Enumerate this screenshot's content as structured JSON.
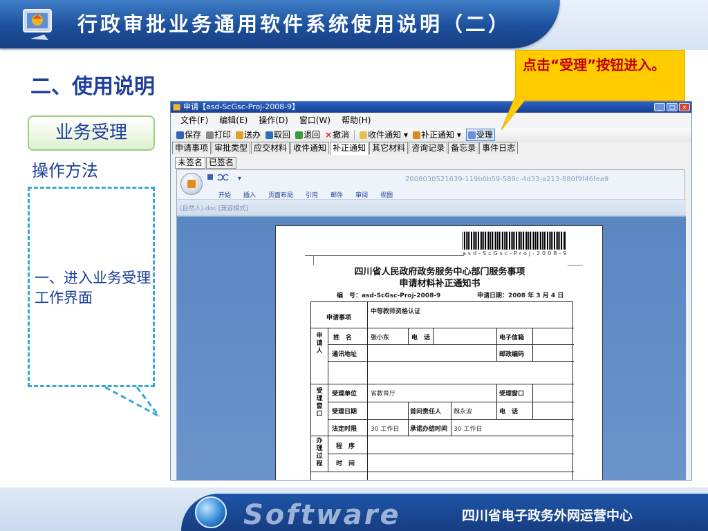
{
  "header": {
    "title": "行政审批业务通用软件系统使用说明（二）"
  },
  "section": {
    "heading": "二、使用说明",
    "button": "业务受理",
    "method": "操作方法",
    "note": "一、进入业务受理工作界面"
  },
  "callout": {
    "text": "点击“受理”按钮进入。"
  },
  "window": {
    "title": "申请【asd-ScGsc-Proj-2008-9】",
    "controls": [
      "_",
      "□",
      "×"
    ],
    "menu": [
      "文件(F)",
      "编辑(E)",
      "操作(D)",
      "窗口(W)",
      "帮助(H)"
    ],
    "toolbar": [
      {
        "label": "保存",
        "icon": "save-icon"
      },
      {
        "label": "打印",
        "icon": "print-icon"
      },
      {
        "label": "送办",
        "icon": "send-icon"
      },
      {
        "label": "取回",
        "icon": "retrieve-icon"
      },
      {
        "label": "退回",
        "icon": "return-icon"
      },
      {
        "label": "撤消",
        "icon": "undo-icon",
        "glyph": "×"
      },
      {
        "label": "收件通知 ▾",
        "icon": "receipt-notice-icon"
      },
      {
        "label": "补正通知 ▾",
        "icon": "supplement-notice-icon"
      },
      {
        "label": "受理",
        "icon": "accept-icon"
      }
    ],
    "tabs": [
      "申请事项",
      "审批类型",
      "应交材料",
      "收件通知",
      "补正通知",
      "其它材料",
      "咨询记录",
      "备忘录",
      "事件日志"
    ],
    "subtabs": [
      "未签名",
      "已签名"
    ]
  },
  "word": {
    "doc_id": "2008030521639-119b0b59-589c-4d33-a213-880f9f46fea9",
    "ribbon": [
      "开始",
      "插入",
      "页面布局",
      "引用",
      "邮件",
      "审阅",
      "视图"
    ],
    "mode": "(自然人).doc [兼容模式]",
    "qat": "▾"
  },
  "doc": {
    "barcode_text": "asd-ScGsc-Proj-2008-9",
    "title1": "四川省人民政府政务服务中心部门服务事项",
    "title2": "申请材料补正通知书",
    "serial": "编　号：asd-ScGsc-Proj-2008-9",
    "date": "申请日期：2008 年 3 月 4 日",
    "form": {
      "item_label": "申请事项",
      "item_value": "中等教师资格认证",
      "applicant_group": "申请人",
      "name_label": "姓　名",
      "name_value": "张小东",
      "phone_label": "电　话",
      "email_label": "电子信箱",
      "address_label": "通讯地址",
      "postcode_label": "邮政编码",
      "window_group": "受理窗口",
      "unit_label": "受理单位",
      "unit_value": "省教育厅",
      "window_label": "受理窗口",
      "date_label": "受理日期",
      "first_label": "首问责任人",
      "first_value": "魏永波",
      "phone2_label": "电　话",
      "limit_label": "法定时限",
      "limit_value": "30 工作日",
      "promise_label": "承诺办结时间",
      "promise_value": "30 工作日",
      "process_group": "办理过程",
      "procedure_label": "程　序",
      "time_label": "时　间"
    }
  },
  "footer": {
    "brand": "Software",
    "org": "四川省电子政务外网运营中心"
  },
  "colors": {
    "header": "#1c4f9b",
    "heading": "#1d3f99",
    "callout_bg": "#ffcc00",
    "callout_text": "#c00000",
    "note_border": "#37a7d8"
  }
}
